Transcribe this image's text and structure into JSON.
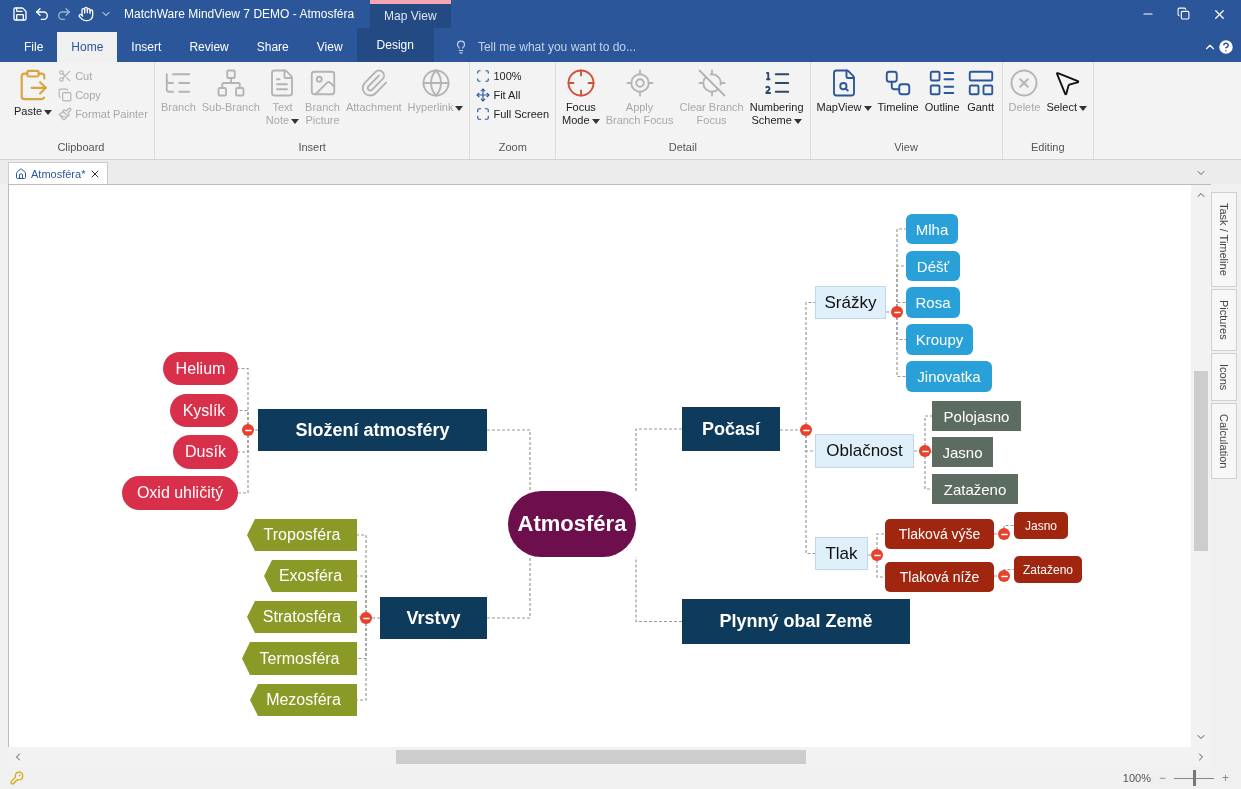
{
  "title_bar": {
    "title": "MatchWare MindView 7 DEMO - Atmosféra",
    "context_label": "Map View"
  },
  "menu_tabs": [
    {
      "label": "File",
      "selected": false,
      "context": false
    },
    {
      "label": "Home",
      "selected": true,
      "context": false
    },
    {
      "label": "Insert",
      "selected": false,
      "context": false
    },
    {
      "label": "Review",
      "selected": false,
      "context": false
    },
    {
      "label": "Share",
      "selected": false,
      "context": false
    },
    {
      "label": "View",
      "selected": false,
      "context": false
    },
    {
      "label": "Design",
      "selected": false,
      "context": true
    }
  ],
  "tell_me": {
    "placeholder": "Tell me what you want to do..."
  },
  "ribbon": {
    "groups": [
      {
        "label": "Clipboard",
        "buttons": [
          {
            "label": "Paste",
            "kind": "large",
            "dropdown": true,
            "disabled": false
          },
          {
            "label": "Cut",
            "kind": "small",
            "dropdown": false,
            "disabled": true
          },
          {
            "label": "Copy",
            "kind": "small",
            "dropdown": false,
            "disabled": true
          },
          {
            "label": "Format Painter",
            "kind": "small",
            "dropdown": false,
            "disabled": true
          }
        ]
      },
      {
        "label": "Insert",
        "buttons": [
          {
            "label": "Branch",
            "kind": "large",
            "dropdown": false,
            "disabled": true
          },
          {
            "label": "Sub-Branch",
            "kind": "large",
            "dropdown": false,
            "disabled": true
          },
          {
            "label": "Text\nNote",
            "kind": "large",
            "dropdown": true,
            "disabled": true
          },
          {
            "label": "Branch\nPicture",
            "kind": "large",
            "dropdown": false,
            "disabled": true
          },
          {
            "label": "Attachment",
            "kind": "large",
            "dropdown": false,
            "disabled": true
          },
          {
            "label": "Hyperlink",
            "kind": "large",
            "dropdown": true,
            "disabled": true
          }
        ]
      },
      {
        "label": "Zoom",
        "buttons": [
          {
            "label": "100%",
            "kind": "small",
            "dropdown": false,
            "disabled": false
          },
          {
            "label": "Fit All",
            "kind": "small",
            "dropdown": false,
            "disabled": false
          },
          {
            "label": "Full Screen",
            "kind": "small",
            "dropdown": false,
            "disabled": false
          }
        ]
      },
      {
        "label": "Detail",
        "buttons": [
          {
            "label": "Focus\nMode",
            "kind": "large",
            "dropdown": true,
            "disabled": false
          },
          {
            "label": "Apply\nBranch Focus",
            "kind": "large",
            "dropdown": false,
            "disabled": true
          },
          {
            "label": "Clear Branch\nFocus",
            "kind": "large",
            "dropdown": false,
            "disabled": true
          },
          {
            "label": "Numbering\nScheme",
            "kind": "large",
            "dropdown": true,
            "disabled": false
          }
        ]
      },
      {
        "label": "View",
        "buttons": [
          {
            "label": "MapView",
            "kind": "large",
            "dropdown": true,
            "disabled": false
          },
          {
            "label": "Timeline",
            "kind": "large",
            "dropdown": false,
            "disabled": false
          },
          {
            "label": "Outline",
            "kind": "large",
            "dropdown": false,
            "disabled": false
          },
          {
            "label": "Gantt",
            "kind": "large",
            "dropdown": false,
            "disabled": false
          }
        ]
      },
      {
        "label": "Editing",
        "buttons": [
          {
            "label": "Delete",
            "kind": "large",
            "dropdown": false,
            "disabled": true
          },
          {
            "label": "Select",
            "kind": "large",
            "dropdown": true,
            "disabled": false
          }
        ]
      }
    ]
  },
  "document_tabs": [
    {
      "label": "Atmosféra*",
      "selected": true
    }
  ],
  "map": {
    "label": "Atmosféra",
    "kind": "central",
    "children": [
      {
        "label": "Složení atmosféry",
        "kind": "main",
        "expanded": true,
        "children": [
          {
            "label": "Helium",
            "kind": "pill"
          },
          {
            "label": "Kyslík",
            "kind": "pill"
          },
          {
            "label": "Dusík",
            "kind": "pill"
          },
          {
            "label": "Oxid uhličitý",
            "kind": "pill"
          }
        ]
      },
      {
        "label": "Vrstvy",
        "kind": "main",
        "expanded": true,
        "children": [
          {
            "label": "Troposféra",
            "kind": "hexagon"
          },
          {
            "label": "Exosféra",
            "kind": "hexagon"
          },
          {
            "label": "Stratosféra",
            "kind": "hexagon"
          },
          {
            "label": "Termosféra",
            "kind": "hexagon"
          },
          {
            "label": "Mezosféra",
            "kind": "hexagon"
          }
        ]
      },
      {
        "label": "Počasí",
        "kind": "main",
        "expanded": true,
        "children": [
          {
            "label": "Srážky",
            "kind": "label",
            "expanded": true,
            "children": [
              {
                "label": "Mlha",
                "kind": "bubble"
              },
              {
                "label": "Déšť",
                "kind": "bubble"
              },
              {
                "label": "Rosa",
                "kind": "bubble"
              },
              {
                "label": "Kroupy",
                "kind": "bubble"
              },
              {
                "label": "Jinovatka",
                "kind": "bubble"
              }
            ]
          },
          {
            "label": "Oblačnost",
            "kind": "label",
            "expanded": true,
            "children": [
              {
                "label": "Polojasno",
                "kind": "box"
              },
              {
                "label": "Jasno",
                "kind": "box"
              },
              {
                "label": "Zataženo",
                "kind": "box"
              }
            ]
          },
          {
            "label": "Tlak",
            "kind": "label",
            "expanded": true,
            "children": [
              {
                "label": "Tlaková výše",
                "kind": "rounded",
                "expanded": true,
                "children": [
                  {
                    "label": "Jasno",
                    "kind": "tag"
                  }
                ]
              },
              {
                "label": "Tlaková níže",
                "kind": "rounded",
                "expanded": true,
                "children": [
                  {
                    "label": "Zataženo",
                    "kind": "tag"
                  }
                ]
              }
            ]
          }
        ]
      },
      {
        "label": "Plynný obal Země",
        "kind": "main"
      }
    ]
  },
  "side_tabs": [
    {
      "label": "Task / Timeline"
    },
    {
      "label": "Pictures"
    },
    {
      "label": "Icons"
    },
    {
      "label": "Calculation"
    }
  ],
  "status_bar": {
    "zoom": "100%",
    "zoom_out": "−",
    "zoom_in": "+",
    "zoom_slider": {
      "level": 0.5
    }
  }
}
